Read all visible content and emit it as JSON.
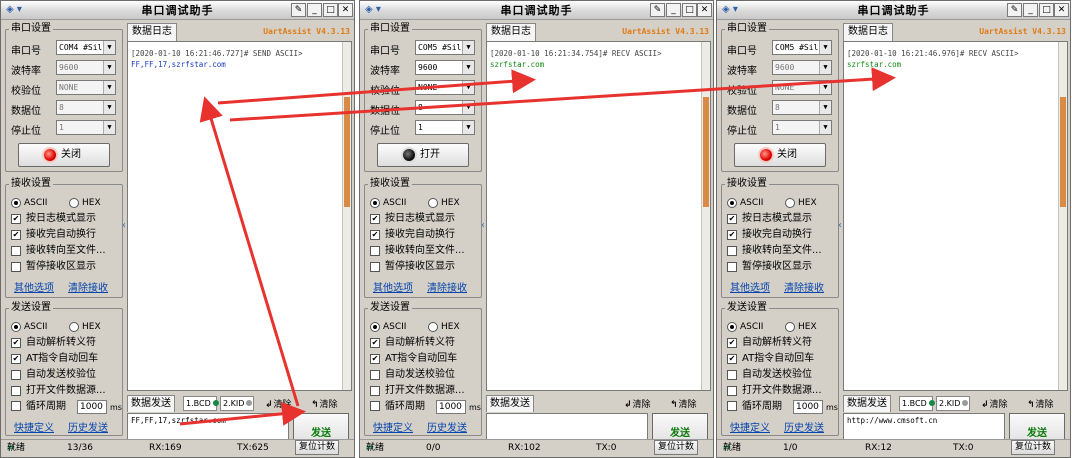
{
  "common": {
    "title": "串口调试助手",
    "brand": "UartAssist V4.3.13",
    "group_port": "串口设置",
    "labels": {
      "port": "串口号",
      "baud": "波特率",
      "parity": "校验位",
      "databits": "数据位",
      "stopbits": "停止位"
    },
    "group_recv": "接收设置",
    "group_send": "发送设置",
    "ascii": "ASCII",
    "hex": "HEX",
    "recv_opts": [
      "按日志模式显示",
      "接收完自动换行",
      "接收转向至文件...",
      "暂停接收区显示"
    ],
    "recv_links": [
      "其他选项",
      "清除接收"
    ],
    "send_opts": [
      "自动解析转义符",
      "AT指令自动回车",
      "自动发送校验位",
      "打开文件数据源..."
    ],
    "cycle_label": "循环周期",
    "cycle_value": "1000",
    "cycle_unit": "ms",
    "send_links": [
      "快捷定义",
      "历史发送"
    ],
    "log_tab": "数据日志",
    "send_tab": "数据发送",
    "hist1": "1.BCD",
    "hist2": "2.KID",
    "clear": "清除",
    "send_button": "发送",
    "reset_button": "复位计数",
    "status_ready": "就绪"
  },
  "windows": [
    {
      "port": "COM4 #Sil",
      "baud": "9600",
      "parity": "NONE",
      "databits": "8",
      "stopbits": "1",
      "open_button": "关闭",
      "recv_checked": [
        true,
        true,
        false,
        false
      ],
      "send_checked": [
        true,
        true,
        false,
        false
      ],
      "log_timestamp": "[2020-01-10 16:21:46.727]# SEND ASCII>",
      "log_data": "FF,FF,17,szrfstar.com",
      "send_text": "FF,FF,17,szrfstar.com",
      "status": {
        "count": "13/36",
        "rx": "RX:169",
        "tx": "TX:625"
      }
    },
    {
      "port": "COM5 #Sil",
      "baud": "9600",
      "parity": "NONE",
      "databits": "8",
      "stopbits": "1",
      "open_button": "打开",
      "recv_checked": [
        true,
        true,
        false,
        false
      ],
      "send_checked": [
        true,
        true,
        false,
        false
      ],
      "log_timestamp": "[2020-01-10 16:21:34.754]# RECV ASCII>",
      "log_data": "szrfstar.com",
      "send_text": "",
      "status": {
        "count": "0/0",
        "rx": "RX:102",
        "tx": "TX:0"
      }
    },
    {
      "port": "COM5 #Sil",
      "baud": "9600",
      "parity": "NONE",
      "databits": "8",
      "stopbits": "1",
      "open_button": "关闭",
      "recv_checked": [
        true,
        true,
        false,
        false
      ],
      "send_checked": [
        true,
        true,
        false,
        false
      ],
      "log_timestamp": "[2020-01-10 16:21:46.976]# RECV ASCII>",
      "log_data": "szrfstar.com",
      "send_text": "http://www.cmsoft.cn",
      "status": {
        "count": "1/0",
        "rx": "RX:12",
        "tx": "TX:0"
      }
    }
  ],
  "annotation_color": "#e8322d"
}
